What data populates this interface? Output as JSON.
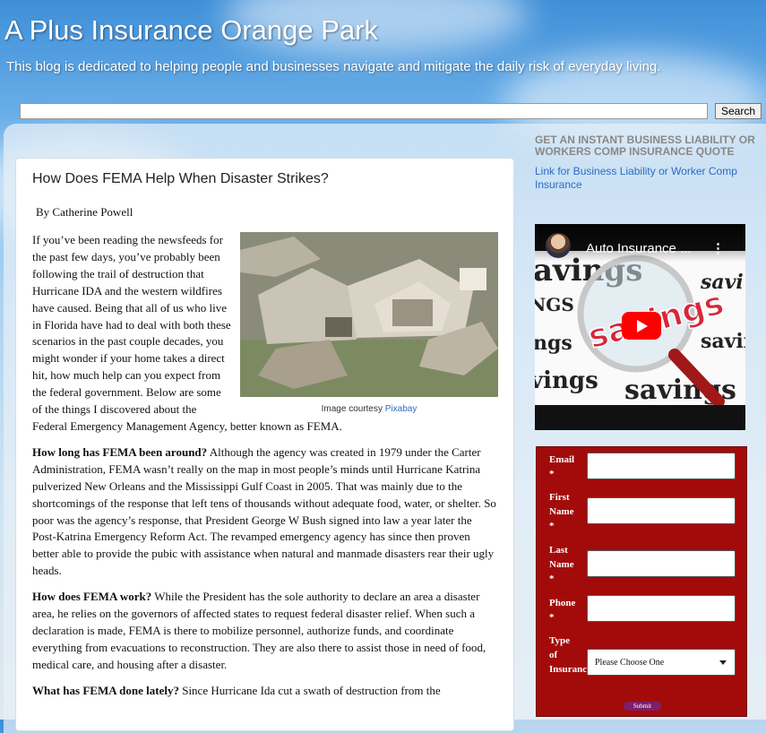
{
  "header": {
    "title": "A Plus Insurance Orange Park",
    "description": "This blog is dedicated to helping people and businesses navigate and mitigate the daily risk of everyday living."
  },
  "search": {
    "value": "",
    "button_label": "Search"
  },
  "post": {
    "title": "How Does FEMA Help When Disaster Strikes?",
    "byline": "By Catherine Powell",
    "image_caption_prefix": "Image courtesy ",
    "image_caption_link": "Pixabay",
    "intro": "If you’ve been reading the newsfeeds for the past few days, you’ve probably been following the trail of destruction that Hurricane IDA and the western wildfires have caused.  Being that all of us who live in Florida have had to deal with both these scenarios in the past couple decades, you might wonder if your home takes a direct hit, how much help can you expect from the federal government.  Below are some of the things I discovered about the Federal Emergency Management Agency, better known as FEMA.",
    "sections": [
      {
        "heading": "How long has FEMA been around?",
        "text": " Although the agency was created in 1979 under the Carter Administration, FEMA wasn’t really on the map in most people’s minds until Hurricane Katrina pulverized New Orleans and the Mississippi Gulf Coast in 2005.  That was mainly due to the shortcomings of the response that left tens of thousands without adequate food, water, or shelter.  So poor was the agency’s response, that President George W Bush signed into law a year later the Post-Katrina Emergency Reform Act.  The revamped emergency agency has since then proven better able to provide the pubic with assistance when natural and manmade disasters rear their ugly heads."
      },
      {
        "heading": "How does FEMA work?",
        "text": "  While the President has the sole authority to declare an area a disaster area, he relies on the governors of affected states to request federal disaster relief.  When such a declaration is made, FEMA is there to mobilize personnel, authorize funds, and coordinate everything from evacuations to reconstruction.  They are also there to assist those in need of food, medical care, and housing after a disaster."
      },
      {
        "heading": "What has FEMA done lately?",
        "text": " Since Hurricane Ida cut a swath of destruction from the"
      }
    ]
  },
  "sidebar": {
    "heading": "GET AN INSTANT BUSINESS LIABILITY OR WORKERS COMP INSURANCE QUOTE",
    "link": "Link for Business Liability or Worker Comp Insurance",
    "video": {
      "title": "Auto Insurance ...",
      "icon_play": "play-icon",
      "icon_menu": "kebab-menu-icon"
    },
    "form": {
      "email_label": "Email *",
      "first_name_label": "First Name *",
      "last_name_label": "Last Name *",
      "phone_label": "Phone *",
      "type_label": "Type of Insurance*",
      "type_selected": "Please Choose One",
      "submit_label": "Submit"
    }
  }
}
